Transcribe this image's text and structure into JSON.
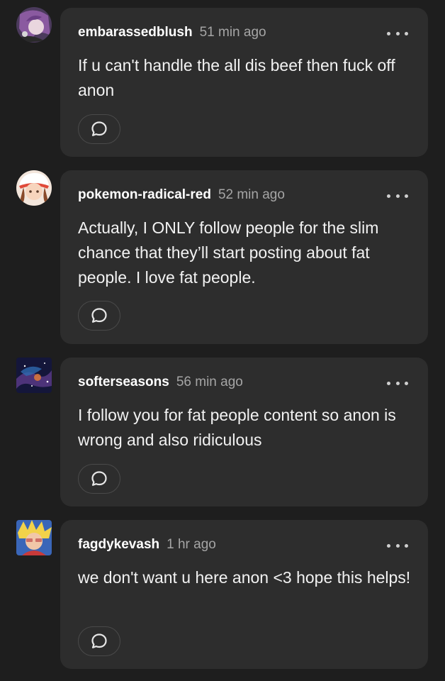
{
  "comments": [
    {
      "username": "embarassedblush",
      "time": "51 min ago",
      "text": "If u can't handle the all dis beef then fuck off anon",
      "avatar_icon": "purple-haired-character-avatar",
      "reply_icon": "speech-bubble-icon",
      "more_icon": "ellipsis-icon"
    },
    {
      "username": "pokemon-radical-red",
      "time": "52 min ago",
      "text": "Actually, I ONLY follow people for the slim chance that they’ll start posting about fat people. I love fat people.",
      "avatar_icon": "trainer-girl-avatar",
      "reply_icon": "speech-bubble-icon",
      "more_icon": "ellipsis-icon"
    },
    {
      "username": "softerseasons",
      "time": "56 min ago",
      "text": "I follow you for fat people content so anon is wrong and also ridiculous",
      "avatar_icon": "galaxy-avatar",
      "reply_icon": "speech-bubble-icon",
      "more_icon": "ellipsis-icon"
    },
    {
      "username": "fagdykevash",
      "time": "1 hr ago",
      "text": "we don't want u here anon <3 hope this helps!",
      "avatar_icon": "blonde-character-avatar",
      "reply_icon": "speech-bubble-icon",
      "more_icon": "ellipsis-icon"
    }
  ],
  "colors": {
    "background": "#1e1e1e",
    "card": "#2d2d2d",
    "text": "#f2f2f2",
    "muted": "#a5a5a5"
  }
}
